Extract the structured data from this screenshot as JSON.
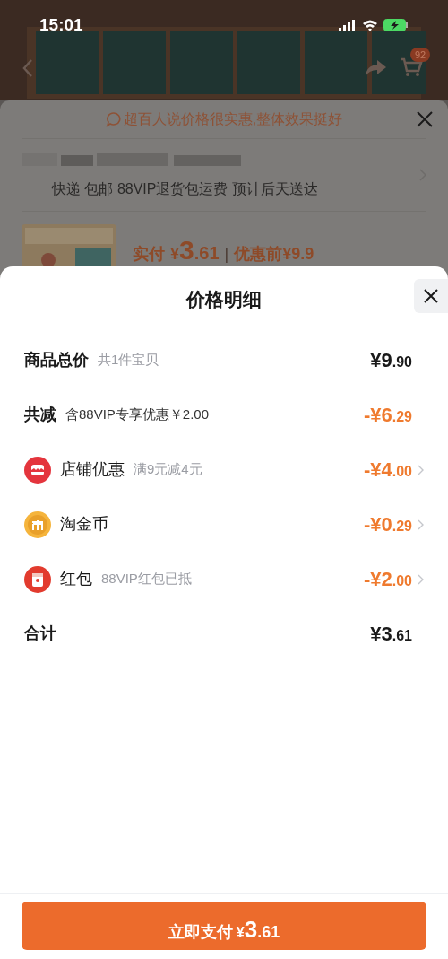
{
  "status_bar": {
    "time": "15:01"
  },
  "nav": {
    "cart_badge": "92"
  },
  "behind_sheet": {
    "notice": "超百人说价格很实惠,整体效果挺好",
    "delivery": "快递 包邮 88VIP退货包运费 预计后天送达",
    "paid_label": "实付",
    "paid_currency": "¥",
    "paid_major": "3",
    "paid_minor": ".61",
    "separator": "|",
    "original_price": "优惠前¥9.9"
  },
  "sheet": {
    "title": "价格明细",
    "rows": [
      {
        "kind": "plain",
        "label": "商品总价",
        "note": "共1件宝贝",
        "discount": false,
        "amount_major": "¥9",
        "amount_minor": ".90",
        "has_arrow": false
      },
      {
        "kind": "plain",
        "label": "共减",
        "note": "含88VIP专享优惠￥2.00",
        "discount": true,
        "amount_major": "-¥6",
        "amount_minor": ".29",
        "has_arrow": false
      },
      {
        "kind": "shop",
        "label": "店铺优惠",
        "note": "满9元减4元",
        "discount": true,
        "amount_major": "-¥4",
        "amount_minor": ".00",
        "has_arrow": true
      },
      {
        "kind": "coin",
        "label": "淘金币",
        "discount": true,
        "amount_major": "-¥0",
        "amount_minor": ".29",
        "has_arrow": true
      },
      {
        "kind": "redpacket",
        "label": "红包",
        "note": "88VIP红包已抵",
        "discount": true,
        "amount_major": "-¥2",
        "amount_minor": ".00",
        "has_arrow": true
      },
      {
        "kind": "total",
        "label": "合计",
        "discount": false,
        "amount_major": "¥3",
        "amount_minor": ".61",
        "has_arrow": false
      }
    ],
    "pay_button": {
      "label": "立即支付",
      "currency": "¥",
      "major": "3",
      "minor": ".61"
    }
  }
}
